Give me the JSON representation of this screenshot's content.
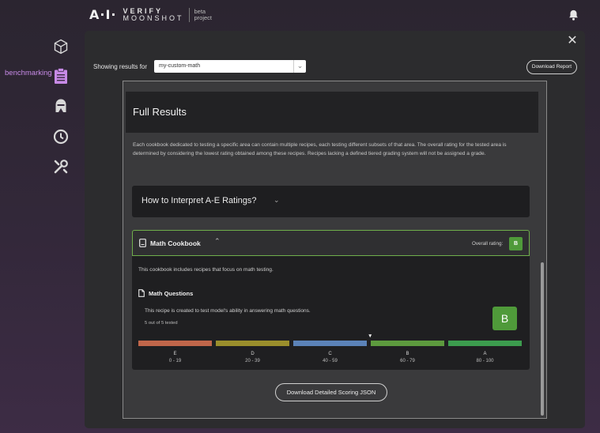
{
  "brand": {
    "mark": "A·I·",
    "line1": "VERIFY",
    "line2": "MOONSHOT",
    "beta1": "beta",
    "beta2": "project"
  },
  "sidebar": {
    "active_label": "benchmarking",
    "items": [
      {
        "icon": "cube-icon"
      },
      {
        "icon": "clipboard-icon"
      },
      {
        "icon": "red-team-icon"
      },
      {
        "icon": "history-icon"
      },
      {
        "icon": "tools-icon"
      }
    ]
  },
  "modal": {
    "close_label": "✕",
    "filter_label": "Showing results for",
    "selected_endpoint": "my-custom-math",
    "select_caret": "⌄",
    "download_report_label": "Download Report",
    "title": "Full Results",
    "intro": "Each cookbook dedicated to testing a specific area can contain multiple recipes, each testing different subsets of that area. The overall rating for the tested area is determined by considering the lowest rating obtained among these recipes. Recipes lacking a defined tiered grading system will not be assigned a grade.",
    "interpret_title": "How to Interpret A-E Ratings?",
    "interpret_chevron": "⌄",
    "download_json_label": "Download Detailed Scoring JSON"
  },
  "cookbook": {
    "title": "Math Cookbook",
    "chevron": "⌃",
    "overall_rating_label": "Overall rating:",
    "overall_grade": "B",
    "description": "This cookbook includes recipes that focus on math testing.",
    "recipe": {
      "title": "Math Questions",
      "description": "This recipe is created to test model's ability in answering math questions.",
      "tested": "5 out of 5 tested",
      "grade": "B",
      "marker": "▼",
      "marker_grade": "B",
      "grades": [
        {
          "letter": "E",
          "range": "0 - 19",
          "color": "#c0664a"
        },
        {
          "letter": "D",
          "range": "20 - 39",
          "color": "#9a8e2c"
        },
        {
          "letter": "C",
          "range": "40 - 59",
          "color": "#5b82b8"
        },
        {
          "letter": "B",
          "range": "60 - 79",
          "color": "#5d9a3e"
        },
        {
          "letter": "A",
          "range": "80 - 100",
          "color": "#3c9c4e"
        }
      ]
    }
  }
}
